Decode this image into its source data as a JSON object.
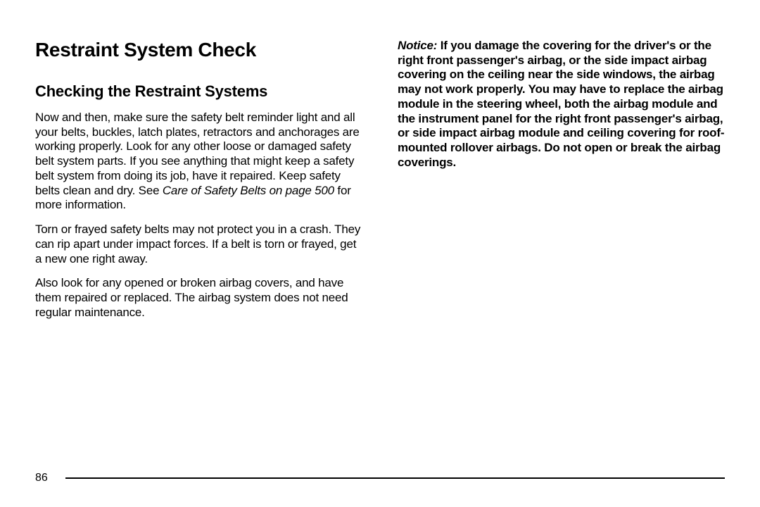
{
  "left": {
    "heading": "Restraint System Check",
    "subheading": "Checking the Restraint Systems",
    "para1_part1": "Now and then, make sure the safety belt reminder light and all your belts, buckles, latch plates, retractors and anchorages are working properly. Look for any other loose or damaged safety belt system parts. If you see anything that might keep a safety belt system from doing its job, have it repaired. Keep safety belts clean and dry. See ",
    "para1_italic": "Care of Safety Belts on page 500",
    "para1_part2": " for more information.",
    "para2": "Torn or frayed safety belts may not protect you in a crash. They can rip apart under impact forces. If a belt is torn or frayed, get a new one right away.",
    "para3": "Also look for any opened or broken airbag covers, and have them repaired or replaced. The airbag system does not need regular maintenance."
  },
  "right": {
    "notice_label": "Notice:",
    "notice_body": "If you damage the covering for the driver's or the right front passenger's airbag, or the side impact airbag covering on the ceiling near the side windows, the airbag may not work properly. You may have to replace the airbag module in the steering wheel, both the airbag module and the instrument panel for the right front passenger's airbag, or side impact airbag module and ceiling covering for roof-mounted rollover airbags. Do not open or break the airbag coverings."
  },
  "footer": {
    "page_number": "86"
  }
}
